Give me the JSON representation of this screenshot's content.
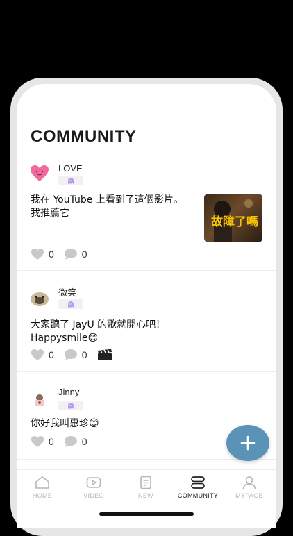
{
  "header": {
    "title": "COMMUNITY"
  },
  "posts": [
    {
      "username": "LOVE",
      "text": "我在 YouTube 上看到了這個影片。我推薦它",
      "thumbnail_text": "故障了嗎",
      "likes": "0",
      "comments": "0"
    },
    {
      "username": "微笑",
      "text": "大家聽了 JayU 的歌就開心吧！Happysmile😊",
      "likes": "0",
      "comments": "0"
    },
    {
      "username": "Jinny",
      "text": "你好我叫惠珍😊",
      "likes": "0",
      "comments": "0"
    }
  ],
  "tabbar": {
    "items": [
      {
        "label": "HOME"
      },
      {
        "label": "VIDEO"
      },
      {
        "label": "NEW"
      },
      {
        "label": "COMMUNITY"
      },
      {
        "label": "MYPAGE"
      }
    ],
    "active": "COMMUNITY"
  },
  "colors": {
    "fab": "#5b93b8",
    "badge_ghost": "#b79cf0",
    "heart_avatar": "#f06a9e"
  }
}
